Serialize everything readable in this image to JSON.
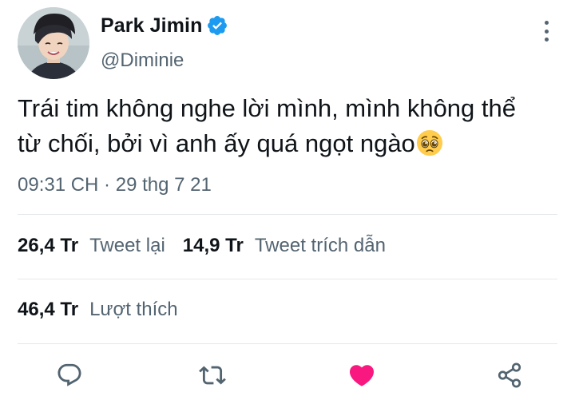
{
  "author": {
    "display_name": "Park Jimin",
    "handle": "@Diminie",
    "verified": true
  },
  "tweet": {
    "text": "Trái tim không nghe lời mình, mình không thể từ chối, bởi vì anh ấy quá ngọt ngào",
    "emoji": "pleading-face",
    "timestamp": "09:31 CH · 29 thg 7 21"
  },
  "stats": {
    "retweets_count": "26,4 Tr",
    "retweets_label": "Tweet lại",
    "quotes_count": "14,9 Tr",
    "quotes_label": "Tweet trích dẫn",
    "likes_count": "46,4 Tr",
    "likes_label": "Lượt thích"
  },
  "actions": {
    "icons": [
      "reply-icon",
      "retweet-icon",
      "like-icon",
      "share-icon"
    ]
  },
  "colors": {
    "primary_text": "#0f1419",
    "secondary_text": "#536471",
    "verified_blue": "#1d9bf0",
    "like_pink": "#f91880",
    "divider": "#e4e8eb"
  }
}
